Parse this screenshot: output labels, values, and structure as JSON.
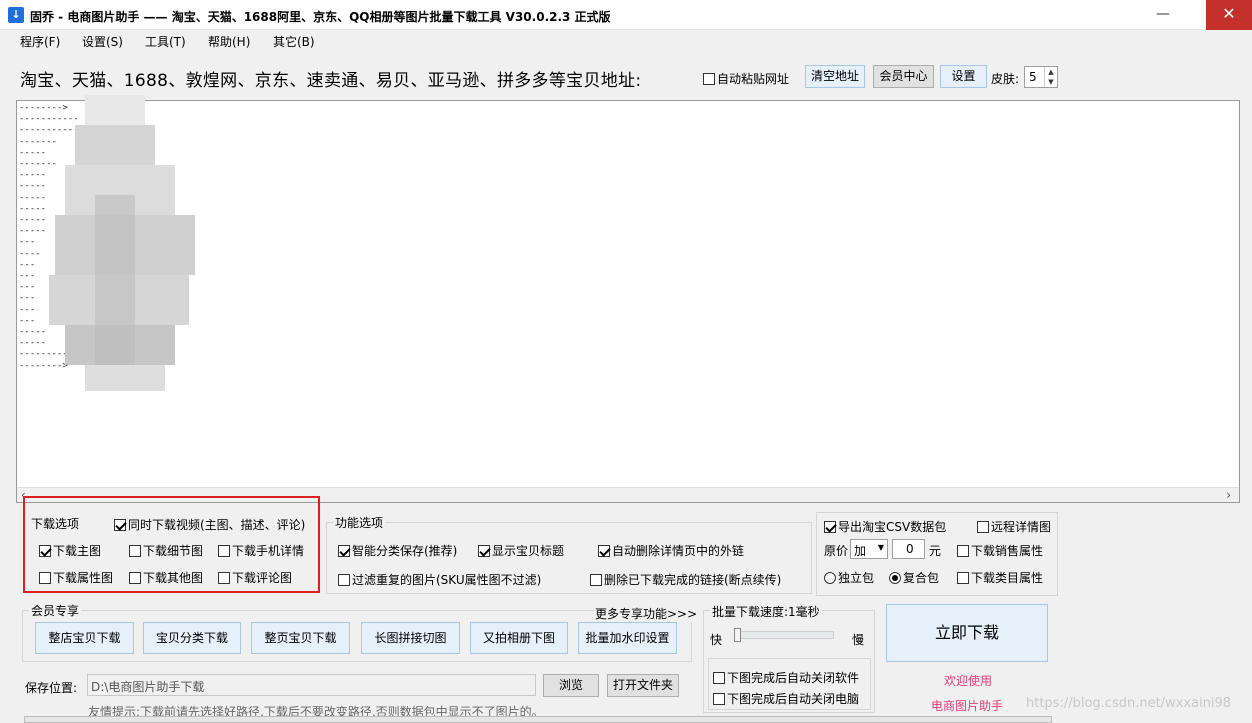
{
  "window": {
    "title": "固乔 - 电商图片助手 —— 淘宝、天猫、1688阿里、京东、QQ相册等图片批量下载工具 V30.0.2.3 正式版",
    "app_icon": "download-icon",
    "min": "—",
    "max": "☐",
    "close": "✕"
  },
  "menu": [
    "程序(F)",
    "设置(S)",
    "工具(T)",
    "帮助(H)",
    "其它(B)"
  ],
  "top": {
    "url_label": "淘宝、天猫、1688、敦煌网、京东、速卖通、易贝、亚马逊、拼多多等宝贝地址:",
    "auto_paste": "自动粘贴网址",
    "clear_btn": "清空地址",
    "member_btn": "会员中心",
    "settings_btn": "设置",
    "skin_label": "皮肤:",
    "skin_value": "5"
  },
  "log": {
    "lines": "-------->\n-----------\n-----------\n-------\n-----\n-------\n-----\n-----\n-----\n-----\n-----\n-----\n---\n----\n---\n---\n---\n---\n---\n---\n-----\n-----\n-----------\n-------->"
  },
  "download_options": {
    "legend": "下载选项",
    "video": "同时下载视频(主图、描述、评论)",
    "main_img": "下载主图",
    "detail_img": "下载细节图",
    "mobile_detail": "下载手机详情",
    "attr_img": "下载属性图",
    "other_img": "下载其他图",
    "review_img": "下载评论图"
  },
  "function_options": {
    "legend": "功能选项",
    "smart_save": "智能分类保存(推荐)",
    "show_title": "显示宝贝标题",
    "auto_delete_links": "自动删除详情页中的外链",
    "filter_dup": "过滤重复的图片(SKU属性图不过滤)",
    "delete_done_links": "删除已下载完成的链接(断点续传)"
  },
  "csv": {
    "export": "导出淘宝CSV数据包",
    "remote_detail": "远程详情图",
    "price_label": "原价",
    "price_op": "加",
    "price_value": "0",
    "unit": "元",
    "sales_attr": "下载销售属性",
    "single_pkg": "独立包",
    "combo_pkg": "复合包",
    "category_attr": "下载类目属性"
  },
  "member": {
    "legend": "会员专享",
    "more": "更多专享功能>>>",
    "buttons": [
      "整店宝贝下载",
      "宝贝分类下载",
      "整页宝贝下载",
      "长图拼接切图",
      "又拍相册下图",
      "批量加水印设置"
    ]
  },
  "speed": {
    "legend": "批量下载速度:1毫秒",
    "fast": "快",
    "slow": "慢",
    "slider_fraction": 0.0,
    "close_soft": "下图完成后自动关闭软件",
    "close_pc": "下图完成后自动关闭电脑"
  },
  "go": {
    "label": "立即下载",
    "welcome1": "欢迎使用",
    "welcome2": "电商图片助手"
  },
  "save": {
    "label": "保存位置:",
    "path": "D:\\电商图片助手下载",
    "browse": "浏览",
    "open_folder": "打开文件夹",
    "tip": "友情提示:下载前请先选择好路径,下载后不要改变路径,否则数据包中显示不了图片的。"
  },
  "watermark": "https://blog.csdn.net/wxxaini98"
}
